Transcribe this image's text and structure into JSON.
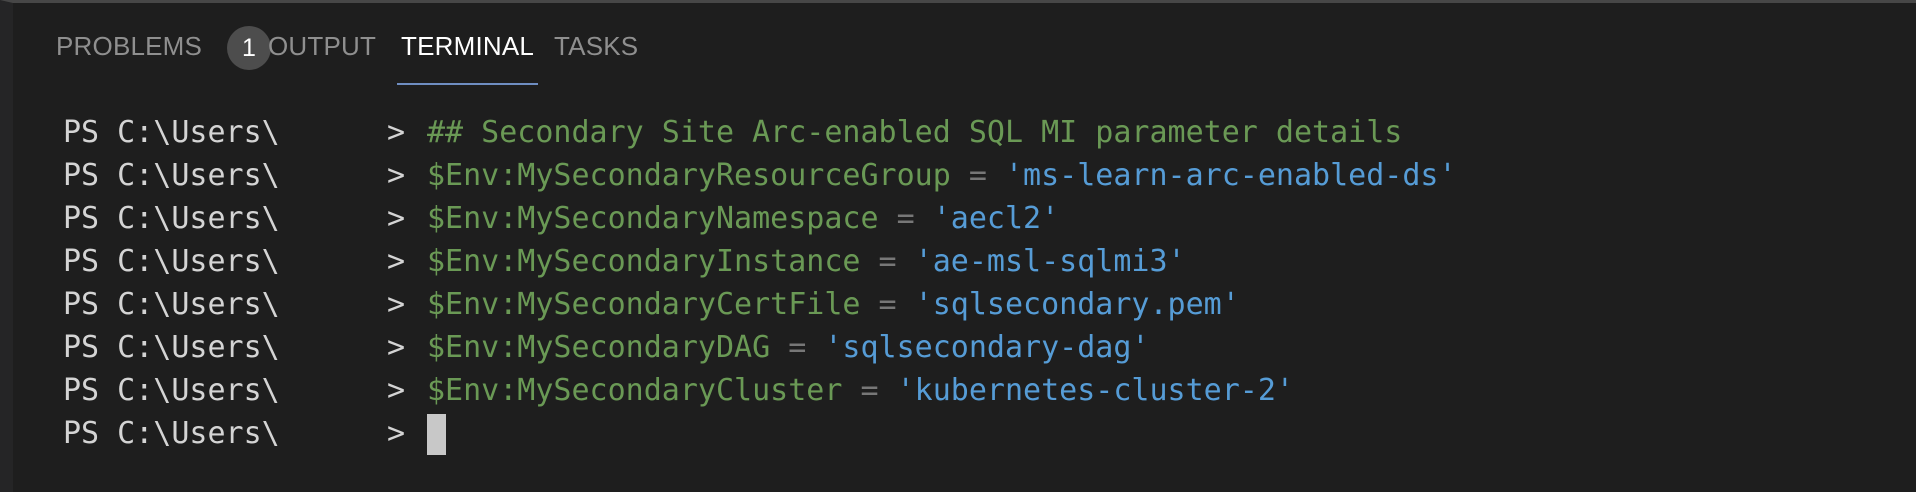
{
  "tabs": {
    "problems": "PROBLEMS",
    "problems_count": "1",
    "output": "OUTPUT",
    "terminal": "TERMINAL",
    "tasks": "TASKS",
    "active": "terminal"
  },
  "terminal": {
    "prompt": "PS C:\\Users\\",
    "prompt_suffix": ">",
    "lines": [
      {
        "comment": "## Secondary Site Arc-enabled SQL MI parameter details"
      },
      {
        "var": "$Env:MySecondaryResourceGroup",
        "op": "=",
        "str": "'ms-learn-arc-enabled-ds'"
      },
      {
        "var": "$Env:MySecondaryNamespace",
        "op": "=",
        "str": "'aecl2'"
      },
      {
        "var": "$Env:MySecondaryInstance",
        "op": "=",
        "str": "'ae-msl-sqlmi3'"
      },
      {
        "var": "$Env:MySecondaryCertFile",
        "op": "=",
        "str": "'sqlsecondary.pem'"
      },
      {
        "var": "$Env:MySecondaryDAG",
        "op": "=",
        "str": "'sqlsecondary-dag'"
      },
      {
        "var": "$Env:MySecondaryCluster",
        "op": "=",
        "str": "'kubernetes-cluster-2'"
      }
    ]
  },
  "colors": {
    "background": "#1e1e1e",
    "comment": "#6a9955",
    "variable": "#6a9955",
    "string": "#569cd6",
    "operator": "#777777",
    "active_tab": "#ffffff",
    "inactive_tab": "#8f8f8f",
    "active_underline": "#6f8ec2"
  }
}
